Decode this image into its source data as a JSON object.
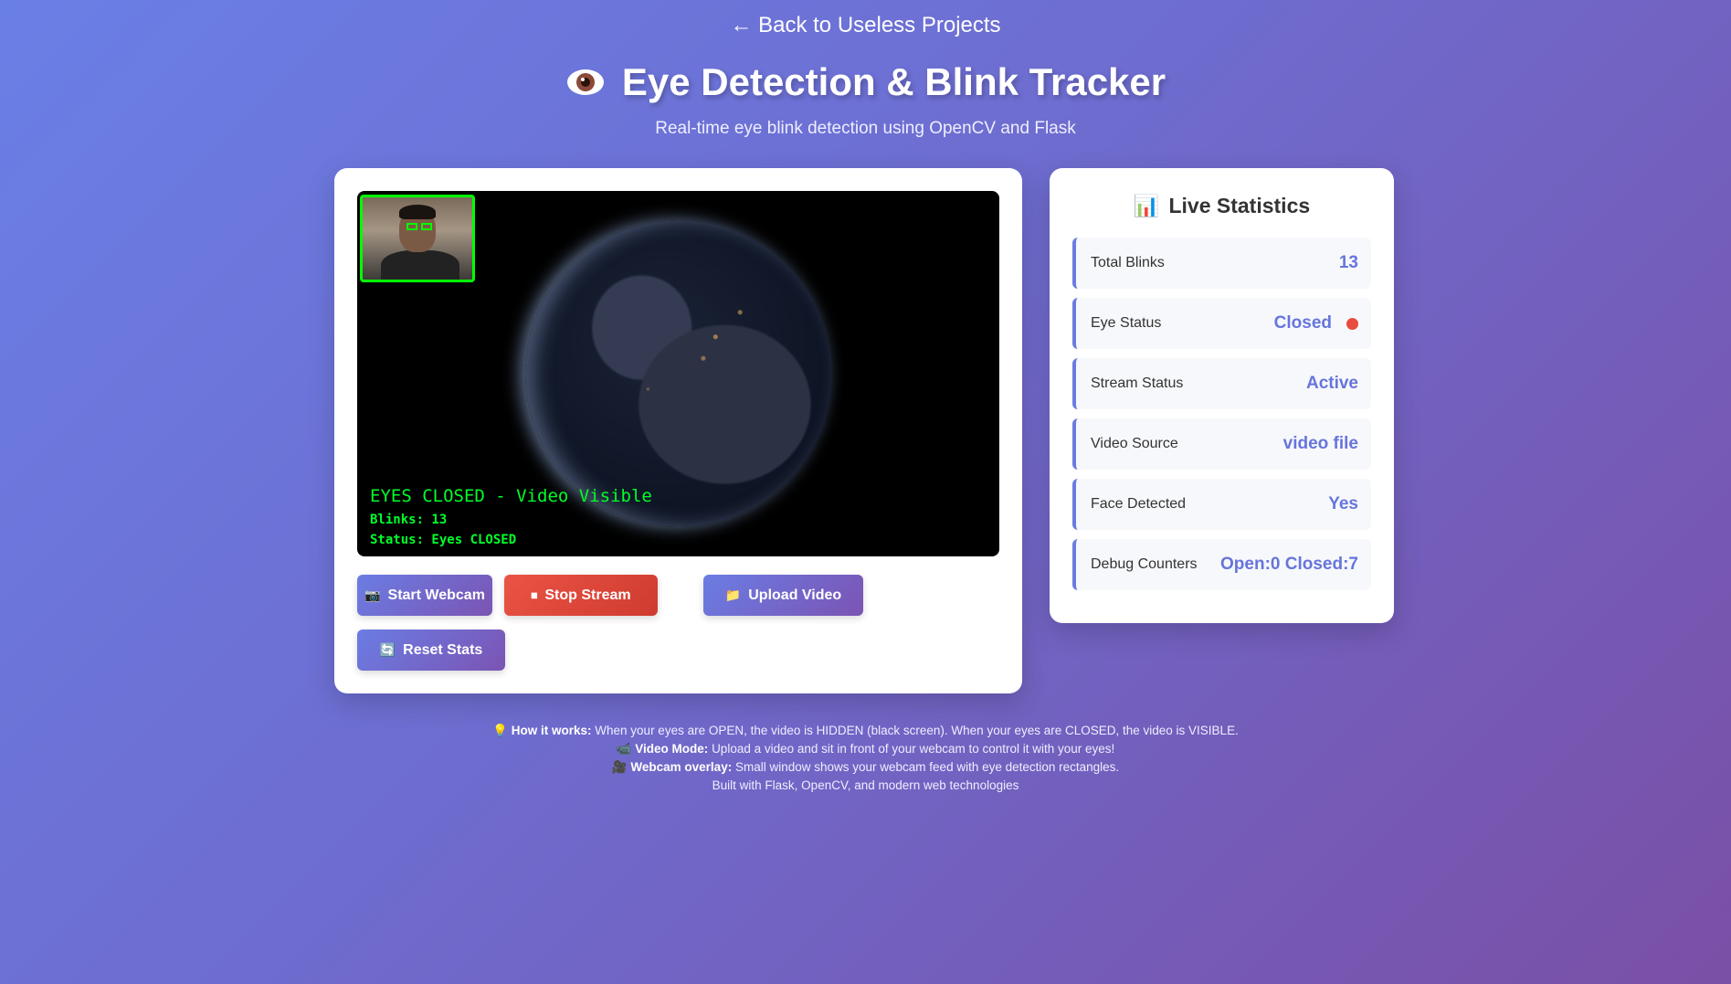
{
  "nav": {
    "back_label": "← Back to Useless Projects"
  },
  "header": {
    "title": "Eye Detection & Blink Tracker",
    "subtitle": "Real-time eye blink detection using OpenCV and Flask",
    "icon": "eye-icon"
  },
  "video": {
    "overlay_main": "EYES CLOSED - Video Visible",
    "overlay_blinks": "Blinks: 13",
    "overlay_status": "Status: Eyes CLOSED"
  },
  "controls": {
    "start_webcam": "Start Webcam",
    "stop_stream": "Stop Stream",
    "upload_video": "Upload Video",
    "reset_stats": "Reset Stats"
  },
  "stats": {
    "title": "Live Statistics",
    "rows": [
      {
        "label": "Total Blinks",
        "value": "13"
      },
      {
        "label": "Eye Status",
        "value": "Closed"
      },
      {
        "label": "Stream Status",
        "value": "Active"
      },
      {
        "label": "Video Source",
        "value": "video file"
      },
      {
        "label": "Face Detected",
        "value": "Yes"
      },
      {
        "label": "Debug Counters",
        "value": "Open:0 Closed:7"
      }
    ]
  },
  "footer": {
    "how_label": "How it works:",
    "how_text": "When your eyes are OPEN, the video is HIDDEN (black screen). When your eyes are CLOSED, the video is VISIBLE.",
    "video_label": "Video Mode:",
    "video_text": "Upload a video and sit in front of your webcam to control it with your eyes!",
    "webcam_label": "Webcam overlay:",
    "webcam_text": "Small window shows your webcam feed with eye detection rectangles.",
    "built_with": "Built with Flask, OpenCV, and modern web technologies"
  },
  "colors": {
    "accent": "#6675dc",
    "danger": "#e74c3c",
    "overlay_green": "#00ff2a"
  }
}
